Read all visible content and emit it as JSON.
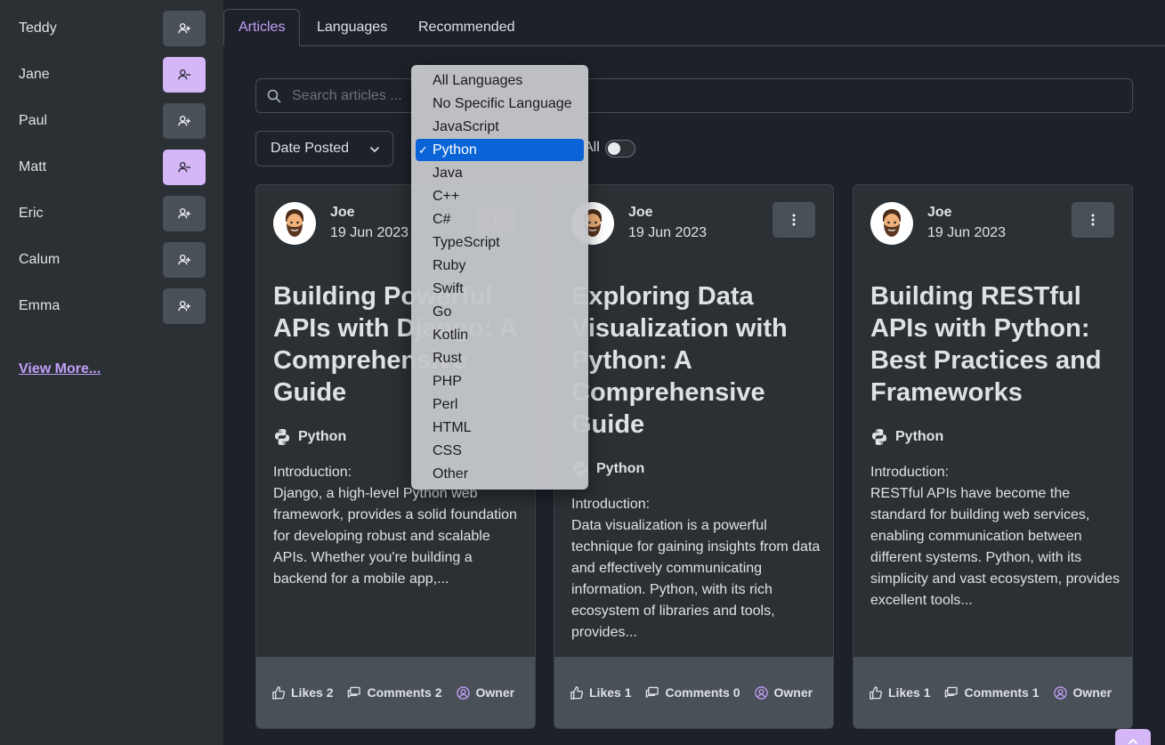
{
  "sidebar": {
    "users": [
      {
        "name": "Teddy",
        "following": false
      },
      {
        "name": "Jane",
        "following": true
      },
      {
        "name": "Paul",
        "following": false
      },
      {
        "name": "Matt",
        "following": true
      },
      {
        "name": "Eric",
        "following": false
      },
      {
        "name": "Calum",
        "following": false
      },
      {
        "name": "Emma",
        "following": false
      }
    ],
    "view_more": "View More..."
  },
  "tabs": [
    "Articles",
    "Languages",
    "Recommended"
  ],
  "active_tab": "Articles",
  "search": {
    "placeholder": "Search articles ..."
  },
  "sort": {
    "value": "Date Posted"
  },
  "filter_toggle": {
    "label": "All",
    "on": false
  },
  "language_dropdown": {
    "options": [
      "All Languages",
      "No Specific Language",
      "JavaScript",
      "Python",
      "Java",
      "C++",
      "C#",
      "TypeScript",
      "Ruby",
      "Swift",
      "Go",
      "Kotlin",
      "Rust",
      "PHP",
      "Perl",
      "HTML",
      "CSS",
      "Other"
    ],
    "selected": "Python",
    "check": "✓"
  },
  "cards": [
    {
      "author": "Joe",
      "date": "19 Jun 2023",
      "title": "Building Powerful APIs with Django: A Comprehensive Guide",
      "language": "Python",
      "excerpt_heading": "Introduction:",
      "excerpt": "Django, a high-level Python web framework, provides a solid foundation for developing robust and scalable APIs. Whether you're building a backend for a mobile app,...",
      "likes": "Likes 2",
      "comments": "Comments 2",
      "owner": "Owner"
    },
    {
      "author": "Joe",
      "date": "19 Jun 2023",
      "title": "Exploring Data Visualization with Python: A Comprehensive Guide",
      "language": "Python",
      "excerpt_heading": "Introduction:",
      "excerpt": "Data visualization is a powerful technique for gaining insights from data and effectively communicating information. Python, with its rich ecosystem of libraries and tools, provides...",
      "likes": "Likes 1",
      "comments": "Comments 0",
      "owner": "Owner"
    },
    {
      "author": "Joe",
      "date": "19 Jun 2023",
      "title": "Building RESTful APIs with Python: Best Practices and Frameworks",
      "language": "Python",
      "excerpt_heading": "Introduction:",
      "excerpt": "RESTful APIs have become the standard for building web services, enabling communication between different systems. Python, with its simplicity and vast ecosystem, provides excellent tools...",
      "likes": "Likes 1",
      "comments": "Comments 1",
      "owner": "Owner"
    }
  ],
  "colors": {
    "accent": "#c29ffa",
    "following_btn": "#d5b6f7",
    "selected_option": "#0a64d8",
    "background": "#1d2129",
    "sidebar": "#2b3035"
  },
  "icons": [
    "user-plus-icon",
    "user-minus-icon",
    "search-icon",
    "chevron-down-icon",
    "kebab-menu-icon",
    "python-icon",
    "thumbs-up-icon",
    "comments-icon",
    "owner-icon",
    "chevron-up-icon"
  ]
}
